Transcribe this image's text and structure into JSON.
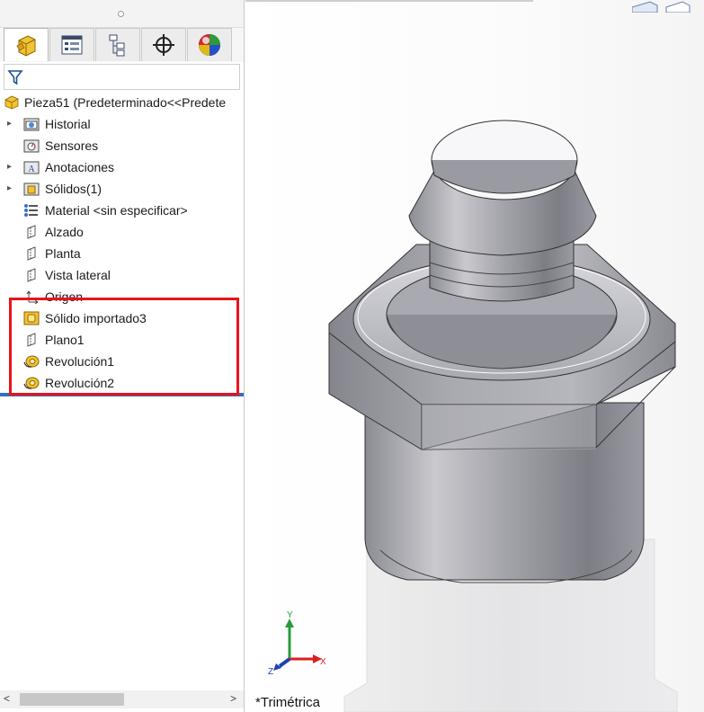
{
  "feature_manager": {
    "tabs": [
      {
        "name": "featuremanager-tab",
        "icon": "part-tree-icon",
        "active": true
      },
      {
        "name": "propertymanager-tab",
        "icon": "property-list-icon",
        "active": false
      },
      {
        "name": "configurationmanager-tab",
        "icon": "configuration-icon",
        "active": false
      },
      {
        "name": "dimxpertmanager-tab",
        "icon": "crosshair-icon",
        "active": false
      },
      {
        "name": "displaymanager-tab",
        "icon": "appearance-sphere-icon",
        "active": false
      }
    ],
    "filter_icon": "funnel-icon",
    "root": {
      "label": "Pieza51  (Predeterminado<<Predete",
      "icon": "part-icon"
    },
    "items": [
      {
        "label": "Historial",
        "icon": "history-folder-icon",
        "expandable": true
      },
      {
        "label": "Sensores",
        "icon": "sensor-folder-icon",
        "expandable": false
      },
      {
        "label": "Anotaciones",
        "icon": "annotations-folder-icon",
        "expandable": true
      },
      {
        "label": "Sólidos(1)",
        "icon": "solid-bodies-folder-icon",
        "expandable": true
      },
      {
        "label": "Material <sin especificar>",
        "icon": "material-icon",
        "expandable": false
      },
      {
        "label": "Alzado",
        "icon": "plane-icon",
        "expandable": false
      },
      {
        "label": "Planta",
        "icon": "plane-icon",
        "expandable": false
      },
      {
        "label": "Vista lateral",
        "icon": "plane-icon",
        "expandable": false
      },
      {
        "label": "Origen",
        "icon": "origin-icon",
        "expandable": false
      },
      {
        "label": "Sólido importado3",
        "icon": "imported-body-icon",
        "expandable": false
      },
      {
        "label": "Plano1",
        "icon": "plane-icon",
        "expandable": false
      },
      {
        "label": "Revolución1",
        "icon": "revolve-icon",
        "expandable": false
      },
      {
        "label": "Revolución2",
        "icon": "revolve-icon",
        "expandable": false
      }
    ]
  },
  "graphics_area": {
    "view_orientation": "*Trimétrica",
    "triad": {
      "x_label": "X",
      "y_label": "Y",
      "z_label": "Z"
    }
  },
  "colors": {
    "highlight": "#e8141b",
    "rollback_bar": "#2e6fc4",
    "axis_x": "#d92020",
    "axis_y": "#2a9a3a",
    "axis_z": "#1f3fb8"
  }
}
